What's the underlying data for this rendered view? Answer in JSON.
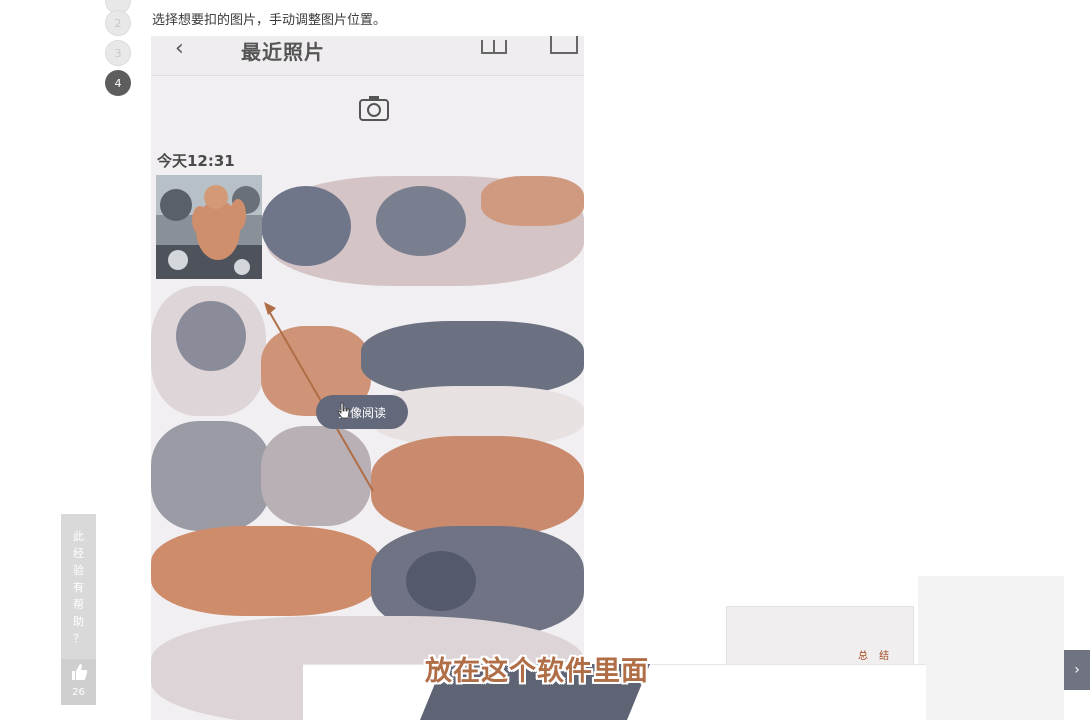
{
  "steps": {
    "visible": [
      "2",
      "3",
      "4"
    ],
    "active": "4"
  },
  "instruction": "选择想要扣的图片，手动调整图片位置。",
  "phone": {
    "title": "最近照片",
    "day_label": "今天12:31",
    "reading_button": "头像阅读"
  },
  "feedback": {
    "chars": [
      "此",
      "经",
      "验",
      "有",
      "帮",
      "助",
      "？"
    ],
    "like_count": "26"
  },
  "summary_label": "总 结",
  "subtitle": "放在这个软件里面",
  "colors": {
    "accent": "#b06e47",
    "slate": "#63687a",
    "step_active": "#5d5d5d"
  },
  "icons": [
    "back-chevron-icon",
    "grid-icon",
    "gallery-icon",
    "camera-icon",
    "cursor-icon",
    "thumbs-up-icon",
    "chevron-right-icon"
  ]
}
